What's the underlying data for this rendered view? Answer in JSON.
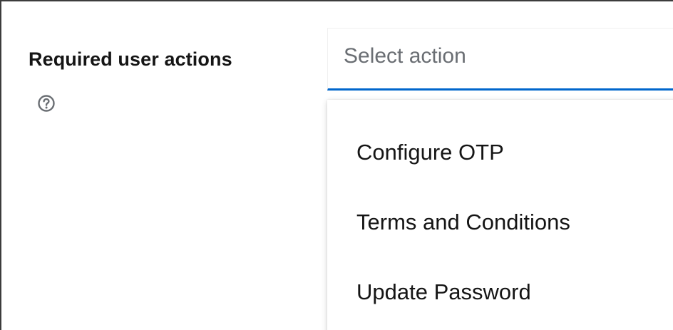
{
  "form": {
    "label": "Required user actions",
    "help_icon": "question-circle-icon",
    "select": {
      "placeholder": "Select action",
      "accent_color": "#0066cc",
      "expanded": true,
      "options": [
        {
          "label": "Configure OTP"
        },
        {
          "label": "Terms and Conditions"
        },
        {
          "label": "Update Password"
        }
      ]
    }
  }
}
